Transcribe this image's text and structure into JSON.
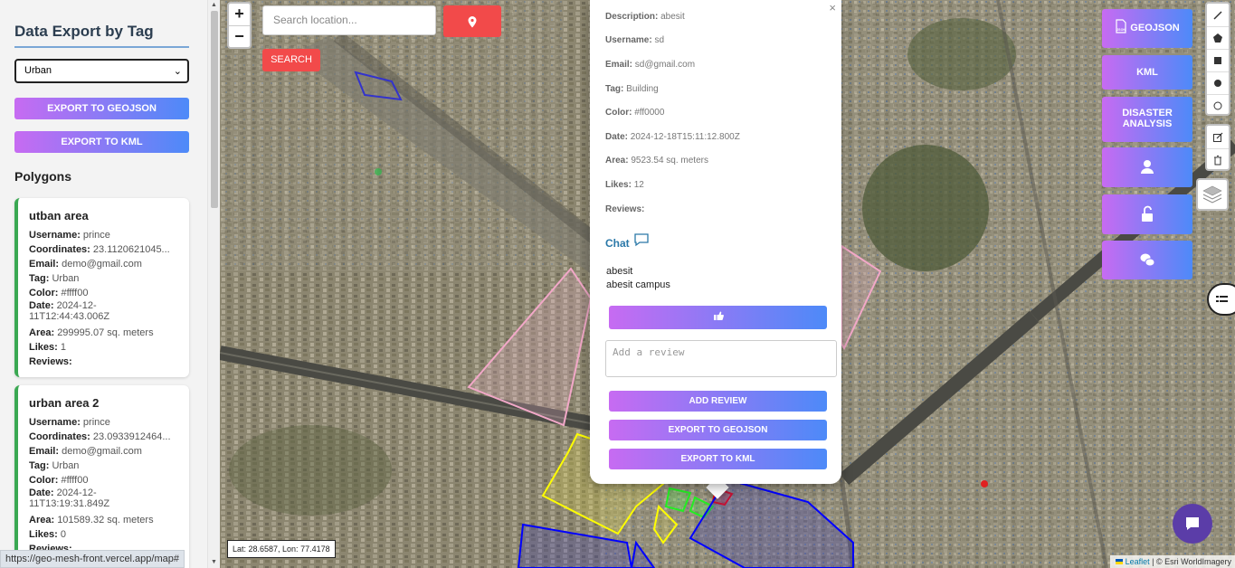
{
  "sidebar": {
    "title": "Data Export by Tag",
    "tag_select_value": "Urban",
    "export_geojson_label": "EXPORT TO GEOJSON",
    "export_kml_label": "EXPORT TO KML",
    "polygons_heading": "Polygons",
    "cards": [
      {
        "title": "utban area",
        "username_label": "Username:",
        "username": "prince",
        "coords_label": "Coordinates:",
        "coords": "23.1120621045...",
        "email_label": "Email:",
        "email": "demo@gmail.com",
        "tag_label": "Tag:",
        "tag": "Urban",
        "color_label": "Color:",
        "color": "#ffff00",
        "date_label": "Date:",
        "date": "2024-12-11T12:44:43.006Z",
        "area_label": "Area:",
        "area": "299995.07 sq. meters",
        "likes_label": "Likes:",
        "likes": "1",
        "reviews_label": "Reviews:"
      },
      {
        "title": "urban area 2",
        "username_label": "Username:",
        "username": "prince",
        "coords_label": "Coordinates:",
        "coords": "23.0933912464...",
        "email_label": "Email:",
        "email": "demo@gmail.com",
        "tag_label": "Tag:",
        "tag": "Urban",
        "color_label": "Color:",
        "color": "#ffff00",
        "date_label": "Date:",
        "date": "2024-12-11T13:19:31.849Z",
        "area_label": "Area:",
        "area": "101589.32 sq. meters",
        "likes_label": "Likes:",
        "likes": "0",
        "reviews_label": "Reviews:"
      }
    ]
  },
  "map": {
    "zoom_in": "+",
    "zoom_out": "−",
    "search_placeholder": "Search location...",
    "search_button": "SEARCH",
    "coords_readout": "Lat: 28.6587, Lon: 77.4178",
    "attribution_leaflet": "Leaflet",
    "attribution_rest": "| © Esri WorldImagery"
  },
  "popup": {
    "close": "×",
    "description_label": "Description:",
    "description": "abesit",
    "username_label": "Username:",
    "username": "sd",
    "email_label": "Email:",
    "email": "sd@gmail.com",
    "tag_label": "Tag:",
    "tag": "Building",
    "color_label": "Color:",
    "color": "#ff0000",
    "date_label": "Date:",
    "date": "2024-12-18T15:11:12.800Z",
    "area_label": "Area:",
    "area": "9523.54 sq. meters",
    "likes_label": "Likes:",
    "likes": "12",
    "reviews_label": "Reviews:",
    "chat_label": "Chat",
    "chat_lines": [
      "abesit",
      "abesit campus"
    ],
    "review_placeholder": "Add a review",
    "add_review": "ADD REVIEW",
    "export_geojson": "EXPORT TO GEOJSON",
    "export_kml": "EXPORT TO KML"
  },
  "toolbar": {
    "geojson": "GEOJSON",
    "geojson_badge": "JSON",
    "kml": "KML",
    "disaster": "DISASTER ANALYSIS"
  },
  "status_bar": {
    "url": "https://geo-mesh-front.vercel.app/map#"
  },
  "colors": {
    "accent_red": "#f24a4a",
    "gradient_start": "#c76bf2",
    "gradient_end": "#4d8af8",
    "card_border": "#3aa852",
    "fab": "#5b3da8"
  }
}
